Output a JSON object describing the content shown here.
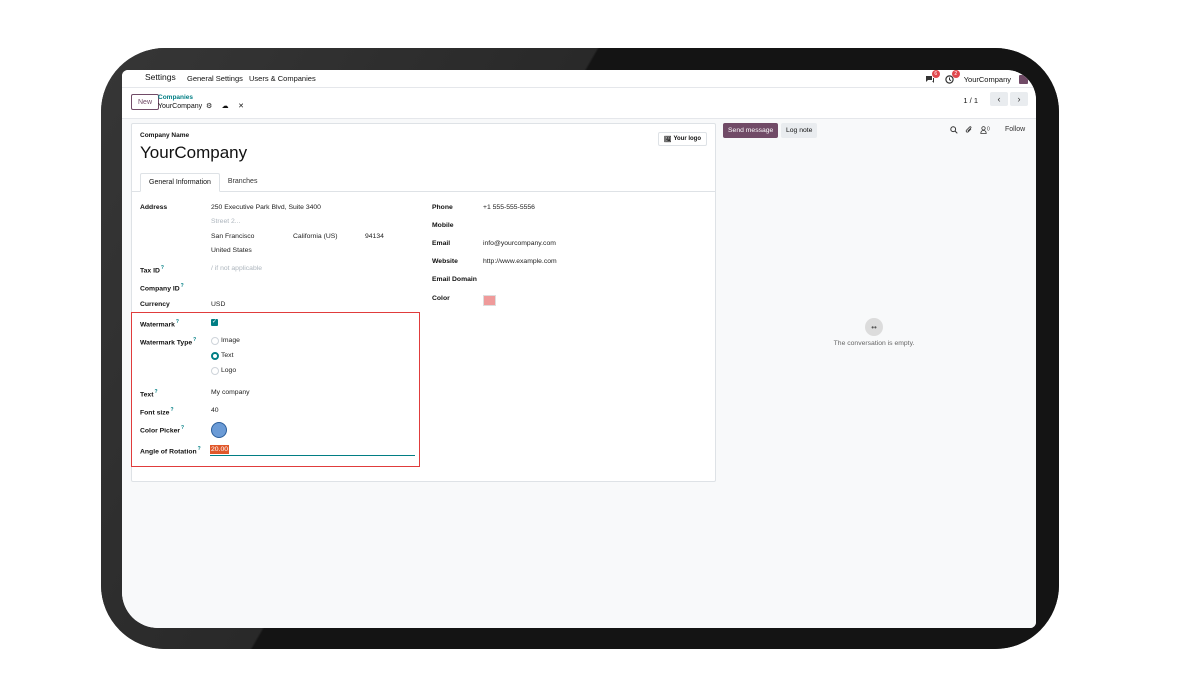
{
  "topbar": {
    "app_name": "Settings",
    "nav": [
      "General Settings",
      "Users & Companies"
    ],
    "messages_badge": "6",
    "activities_badge": "2",
    "company": "YourCompany"
  },
  "control_panel": {
    "new_label": "New",
    "breadcrumb_parent": "Companies",
    "breadcrumb_current": "YourCompany",
    "pager": "1 / 1"
  },
  "form": {
    "company_name_label": "Company Name",
    "company_name": "YourCompany",
    "logo_button": "Your logo",
    "tabs": [
      "General Information",
      "Branches"
    ],
    "left": {
      "address_label": "Address",
      "street": "250 Executive Park Blvd, Suite 3400",
      "street2_placeholder": "Street 2...",
      "city": "San Francisco",
      "state": "California (US)",
      "zip": "94134",
      "country": "United States",
      "tax_id_label": "Tax ID",
      "tax_id_placeholder": "/ if not applicable",
      "company_id_label": "Company ID",
      "currency_label": "Currency",
      "currency": "USD"
    },
    "right": {
      "phone_label": "Phone",
      "phone": "+1 555-555-5556",
      "mobile_label": "Mobile",
      "email_label": "Email",
      "email": "info@yourcompany.com",
      "website_label": "Website",
      "website": "http://www.example.com",
      "email_domain_label": "Email Domain",
      "color_label": "Color",
      "color_value": "#ef9a9a"
    },
    "watermark": {
      "watermark_label": "Watermark",
      "watermark_checked": true,
      "type_label": "Watermark Type",
      "type_options": [
        "Image",
        "Text",
        "Logo"
      ],
      "type_selected": "Text",
      "text_label": "Text",
      "text_value": "My company",
      "font_size_label": "Font size",
      "font_size_value": "40",
      "color_picker_label": "Color Picker",
      "color_picker_value": "#6b9bd6",
      "angle_label": "Angle of Rotation",
      "angle_value": "20.00"
    }
  },
  "chatter": {
    "send_message": "Send message",
    "log_note": "Log note",
    "followers_count": "0",
    "follow": "Follow",
    "empty_text": "The conversation is empty."
  },
  "colors": {
    "brand": "#714b67",
    "accent": "#017e84",
    "highlight_box": "#e03c3c"
  }
}
